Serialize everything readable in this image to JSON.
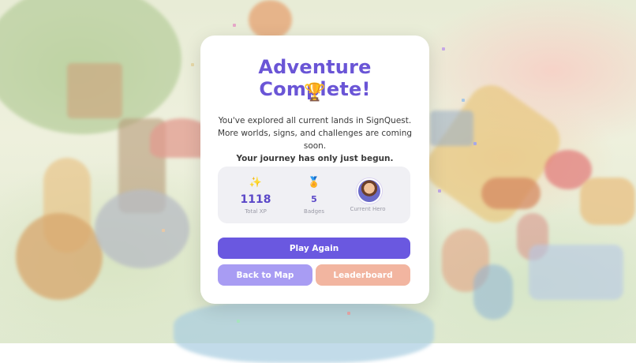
{
  "dialog": {
    "title": "Adventure Complete!",
    "trophy_icon": "🏆",
    "message_line1": "You've explored all current lands in SignQuest.",
    "message_line2": "More worlds, signs, and challenges are coming soon.",
    "message_line3": "Your journey has only just begun."
  },
  "stats": [
    {
      "icon": "sparkles-icon",
      "glyph": "✨",
      "value": "1118",
      "label": "Total XP"
    },
    {
      "icon": "medal-icon",
      "glyph": "🏅",
      "value": "5",
      "label": "Badges"
    },
    {
      "icon": "hero-avatar",
      "value": "",
      "label": "Current Hero"
    }
  ],
  "buttons": {
    "play_again": "Play Again",
    "back_to_map": "Back to Map",
    "leaderboard": "Leaderboard"
  },
  "colors": {
    "title": "#6a55d6",
    "primary_button": "#6a58e0",
    "secondary_button": "#a89cf3",
    "tertiary_button": "#f2b5a0",
    "stat_value": "#5b48c8"
  }
}
